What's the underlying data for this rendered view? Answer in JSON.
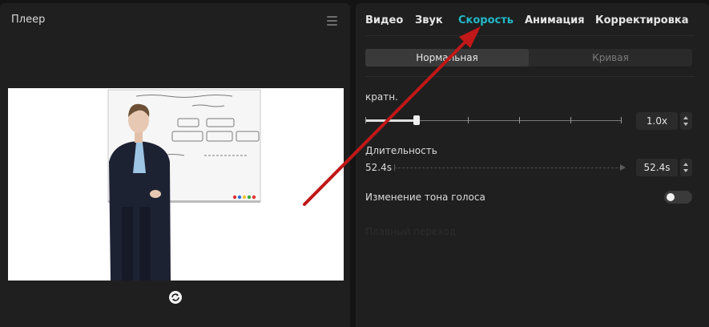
{
  "player": {
    "title": "Плеер",
    "menu_icon": "hamburger-menu-icon",
    "loop_icon": "loop-refresh-icon"
  },
  "inspector": {
    "tabs": [
      {
        "label": "Видео",
        "active": false
      },
      {
        "label": "Звук",
        "active": false
      },
      {
        "label": "Скорость",
        "active": true
      },
      {
        "label": "Анимация",
        "active": false
      },
      {
        "label": "Корректировка",
        "active": false
      }
    ],
    "mode": {
      "normal": "Нормальная",
      "curve": "Кривая",
      "selected": "Нормальная"
    },
    "speed": {
      "label": "кратн.",
      "value": "1.0x",
      "slider_level": 0.2
    },
    "duration": {
      "label": "Длительность",
      "from": "52.4s",
      "to": "52.4s"
    },
    "pitch": {
      "label": "Изменение тона голоса",
      "enabled": false
    },
    "faded_option": "Плавный переход"
  },
  "colors": {
    "accent": "#22b8c8",
    "background": "#141414",
    "panel": "#1f1f1f",
    "annotation_arrow": "#c01818"
  }
}
